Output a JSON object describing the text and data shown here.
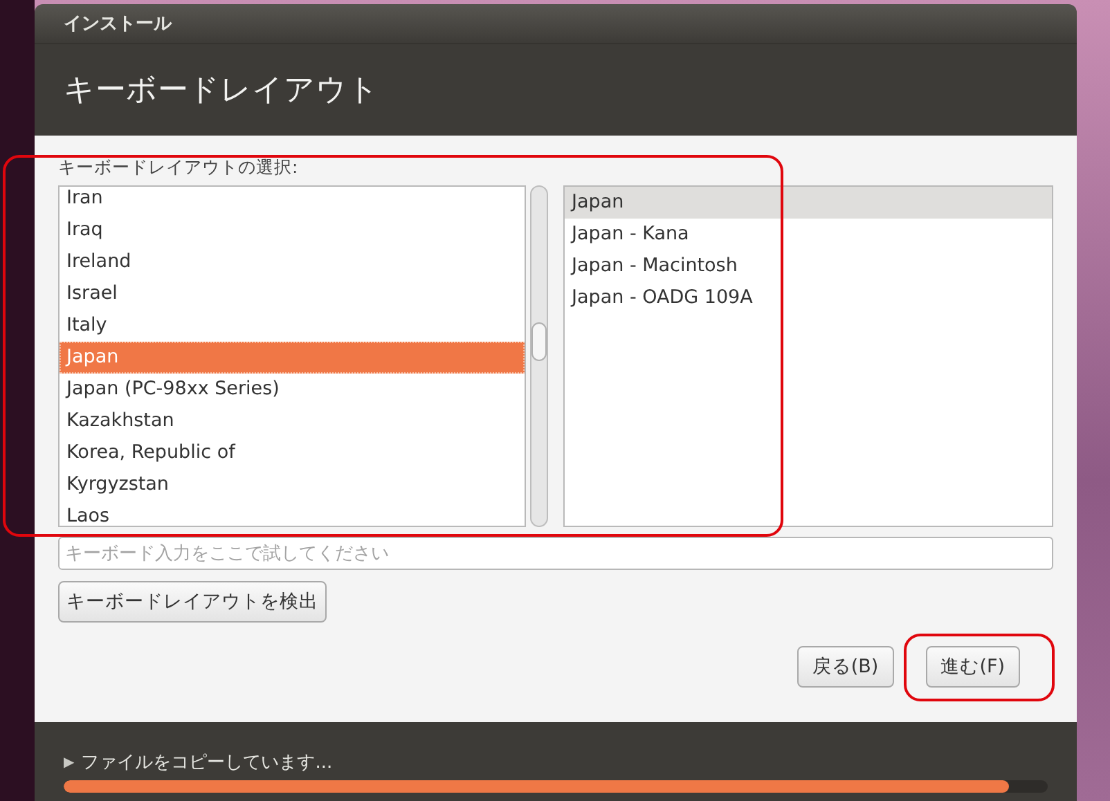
{
  "window": {
    "title": "インストール"
  },
  "header": {
    "title": "キーボードレイアウト"
  },
  "layout_section": {
    "label": "キーボードレイアウトの選択:",
    "highlighted": true
  },
  "layouts": [
    {
      "label": "Iran",
      "selected": false
    },
    {
      "label": "Iraq",
      "selected": false
    },
    {
      "label": "Ireland",
      "selected": false
    },
    {
      "label": "Israel",
      "selected": false
    },
    {
      "label": "Italy",
      "selected": false
    },
    {
      "label": "Japan",
      "selected": true
    },
    {
      "label": "Japan (PC-98xx Series)",
      "selected": false
    },
    {
      "label": "Kazakhstan",
      "selected": false
    },
    {
      "label": "Korea, Republic of",
      "selected": false
    },
    {
      "label": "Kyrgyzstan",
      "selected": false
    },
    {
      "label": "Laos",
      "selected": false
    }
  ],
  "variants": [
    {
      "label": "Japan",
      "selected": true
    },
    {
      "label": "Japan - Kana",
      "selected": false
    },
    {
      "label": "Japan - Macintosh",
      "selected": false
    },
    {
      "label": "Japan - OADG 109A",
      "selected": false
    }
  ],
  "test_field": {
    "placeholder": "キーボード入力をここで試してください"
  },
  "detect_button": {
    "label": "キーボードレイアウトを検出"
  },
  "buttons": [
    {
      "label": "戻る(B)",
      "highlighted": false
    },
    {
      "label": "進む(F)",
      "highlighted": true
    }
  ],
  "status": {
    "text": "ファイルをコピーしています...",
    "expander": "▶",
    "level": 0.96
  }
}
